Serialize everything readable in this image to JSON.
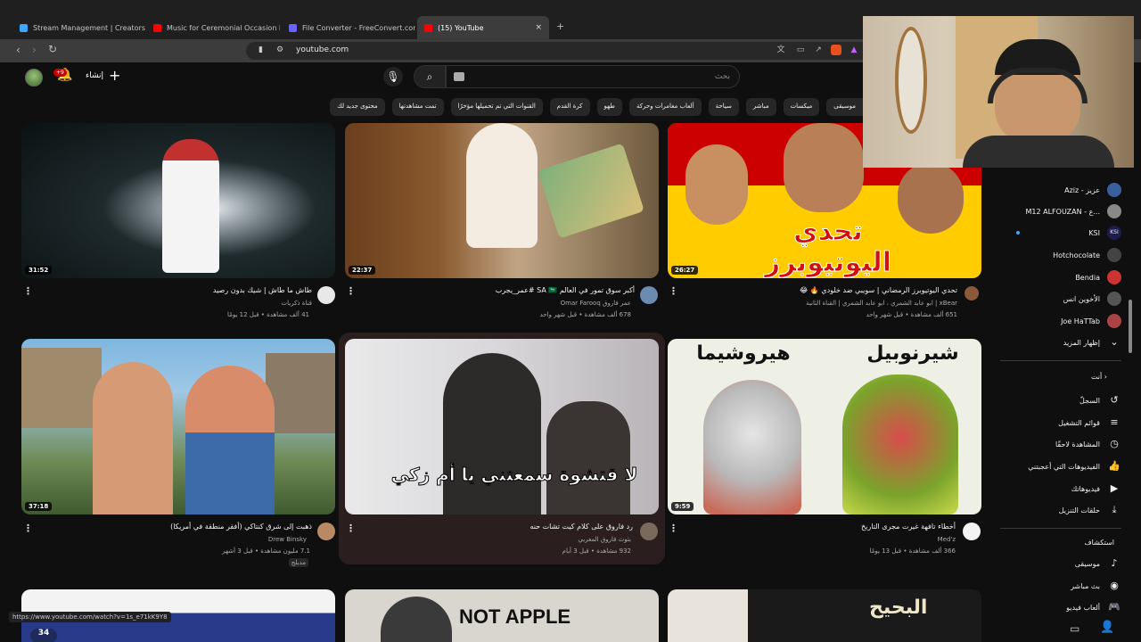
{
  "browser": {
    "tabs": [
      {
        "title": "Stream Management | Creators",
        "color": "#3ea6ff"
      },
      {
        "title": "Music for Ceremonial Occasion Roya",
        "color": "#ff0000"
      },
      {
        "title": "File Converter - FreeConvert.com",
        "color": "#6c63ff"
      },
      {
        "title": "(15) YouTube",
        "color": "#ff0000"
      }
    ],
    "active_tab_close": "×",
    "new_tab": "+",
    "url": "youtube.com",
    "status_url": "https://www.youtube.com/watch?v=1s_e71kK9Y8"
  },
  "header": {
    "notifications_badge": "+9",
    "create_label": "إنشاء",
    "search_placeholder": "بحث"
  },
  "chips": [
    "موسيقى",
    "ميكسات",
    "مباشر",
    "سياحة",
    "ألعاب مغامرات وحركة",
    "طهو",
    "كرة القدم",
    "القنوات التي تم تحميلها مؤخرًا",
    "تمت مشاهدتها",
    "محتوى جديد لك"
  ],
  "chip_edge": "ت",
  "videos": [
    {
      "title": "طاش ما طاش | شيك بدون رصيد",
      "channel": "قناة ذكريات",
      "meta": "41 ألف مشاهدة • قبل 12 يومًا",
      "duration": "31:52"
    },
    {
      "title": "أكبر سوق تمور في العالم SA 🇸🇦 #عمر_يجرب",
      "channel": "عمر فاروق Omar Farooq",
      "meta": "678 ألف مشاهدة • قبل شهر واحد",
      "duration": "22:37"
    },
    {
      "title": "تحدي اليوتيوبرز الرمضاني | سويبي ضد خلودي 🔥 😂",
      "channel": "xBear | ابو عابد الشمري",
      "channel2": "ابو عابد الشمري | القناة الثانية",
      "meta": "651 ألف مشاهدة • قبل شهر واحد",
      "duration": "26:27"
    },
    {
      "title": "ذهبت إلى شرق كنتاكي (أفقر منطقة في أمريكا)",
      "channel": "Drew Binsky",
      "meta": "7.1 مليون مشاهدة • قبل 3 أشهر",
      "extra": "مدبلج",
      "duration": "37:18"
    },
    {
      "title": "رد فاروق على كلام كيت تشات حنه",
      "channel": "بثوث فاروق المغربي",
      "meta": "932 مشاهدة • قبل 3 أيام",
      "duration": ""
    },
    {
      "title": "أخطاء تافهة غيرت مجرى التاريخ",
      "channel": "Med'z",
      "meta": "366 ألف مشاهدة • قبل 13 يومًا",
      "duration": "9:59"
    }
  ],
  "thumb_text": {
    "v2_overlay": "تحدي اليوتيوبرز",
    "v5_overlay": "لا قتشوة سمعتني يا أم زكي",
    "v6_left": "هيروشيما",
    "v6_right": "شيرنوبيل",
    "row3_mid": "NOT APPLE",
    "row3_right": "البحيح",
    "row3_left_badge": "34"
  },
  "sidebar": {
    "subs": [
      {
        "name": "Aziz - عزيز",
        "color": "#3a5f9e"
      },
      {
        "name": "M12 ALFOUZAN - ع...",
        "color": "#888888"
      },
      {
        "name": "KSI",
        "color": "#1d1d4d"
      },
      {
        "name": "Hotchocolate",
        "color": "#444444"
      },
      {
        "name": "Bendia",
        "color": "#cc3333"
      },
      {
        "name": "الأخوين انس",
        "color": "#555555"
      },
      {
        "name": "Joe HaTTab",
        "color": "#aa4444"
      }
    ],
    "show_more": "إظهار المزيد",
    "you_header": "أنت",
    "you_items": [
      "السجلّ",
      "قوائم التشغيل",
      "المشاهدة لاحقًا",
      "الفيديوهات التي أعجبتني",
      "فيديوهاتك",
      "حلقات التنزيل"
    ],
    "explore_header": "استكشاف",
    "explore_items": [
      "موسيقى",
      "بث مباشر",
      "ألعاب فيديو"
    ]
  }
}
